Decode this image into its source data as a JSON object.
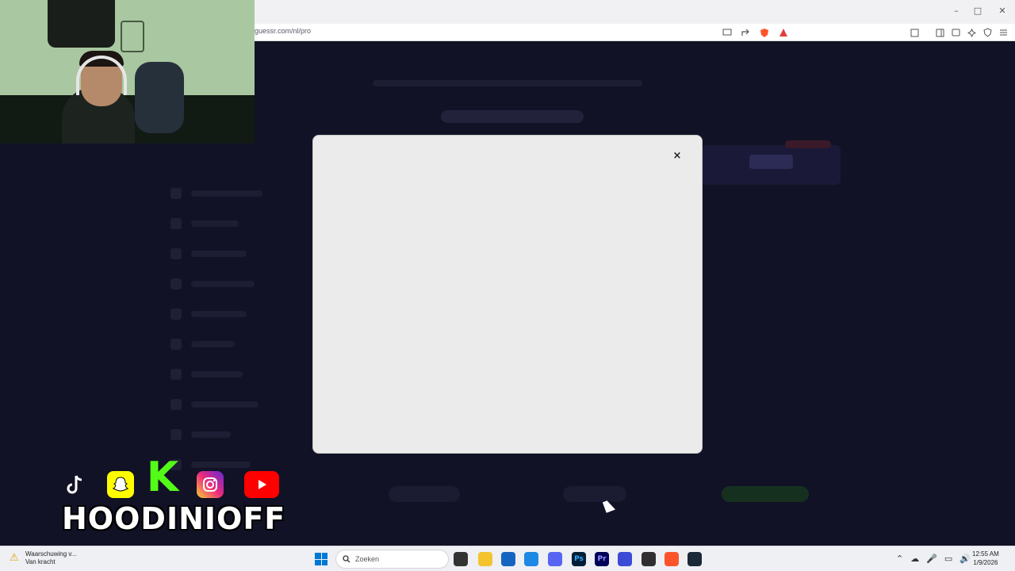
{
  "browser": {
    "url": "guessr.com/nl/pro",
    "window_controls": {
      "minimize": "–",
      "maximize": "□",
      "close": "✕"
    }
  },
  "modal": {
    "close_label": "×"
  },
  "stream_overlay": {
    "socials": [
      "tiktok",
      "snapchat",
      "kick",
      "instagram",
      "youtube"
    ],
    "kick_letter": "K",
    "brand_name": "HOODINIOFF"
  },
  "taskbar": {
    "notification": {
      "line1": "Waarschuwing v...",
      "line2": "Van kracht"
    },
    "search_placeholder": "Zoeken",
    "clock": {
      "time": "12:55 AM",
      "date": "1/9/2026"
    },
    "apps": [
      "file-explorer",
      "folder",
      "store",
      "edge",
      "discord",
      "photoshop",
      "premiere",
      "arc",
      "obs",
      "brave",
      "steam"
    ]
  },
  "colors": {
    "page_background": "#121226",
    "modal_background": "#ebebeb",
    "kick_green": "#53fc18",
    "youtube_red": "#ff0000"
  }
}
